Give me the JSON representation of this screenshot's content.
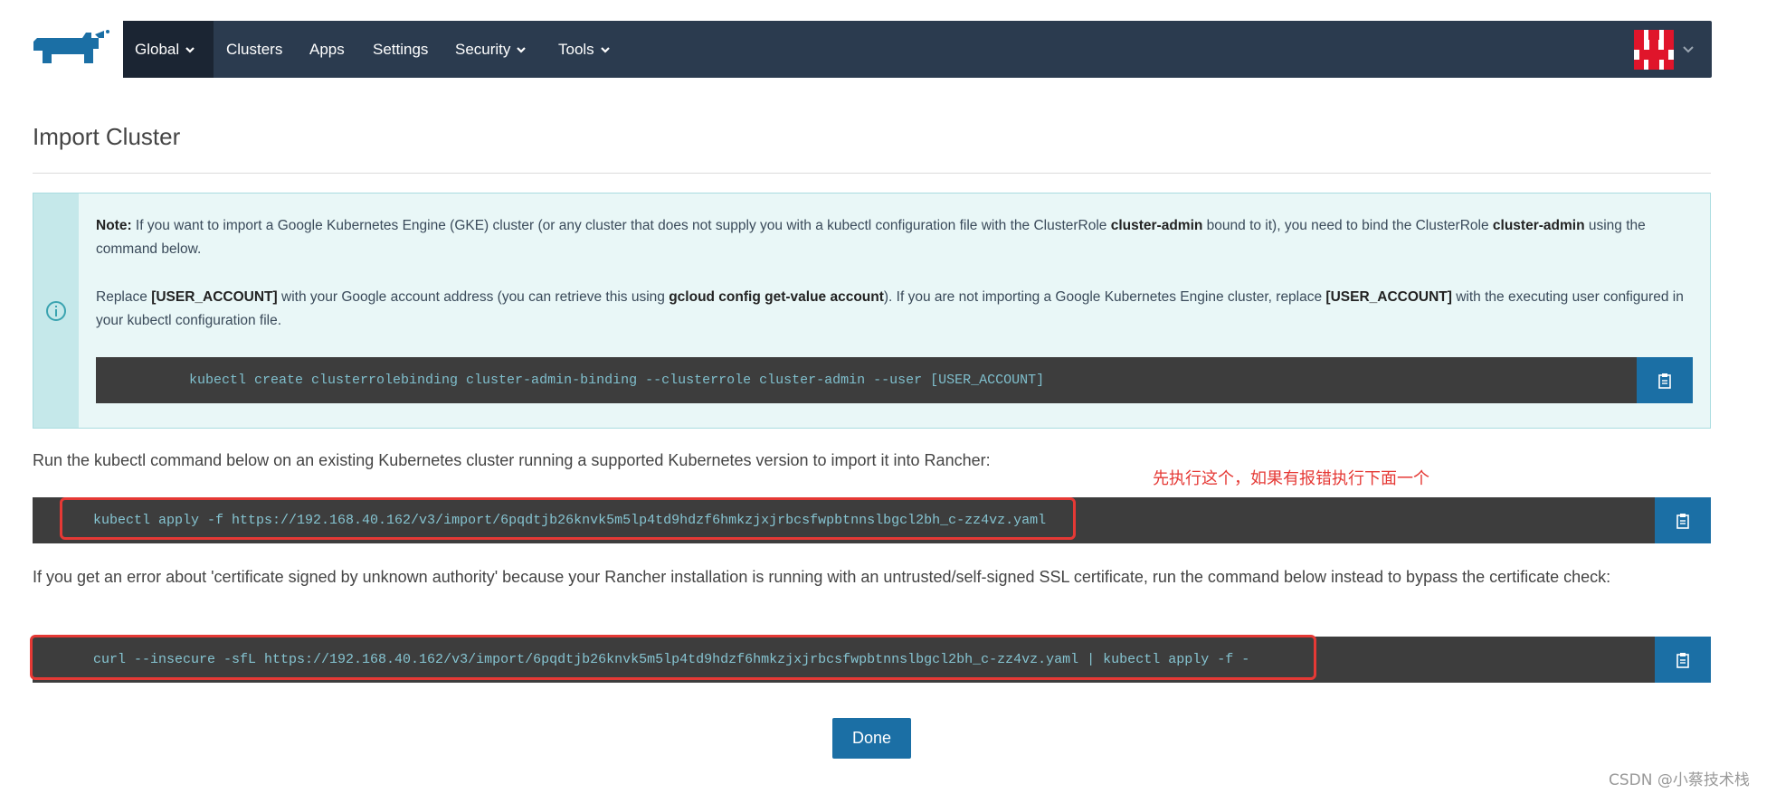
{
  "nav": {
    "global": "Global",
    "clusters": "Clusters",
    "apps": "Apps",
    "settings": "Settings",
    "security": "Security",
    "tools": "Tools"
  },
  "page": {
    "title": "Import Cluster"
  },
  "banner": {
    "note_label": "Note:",
    "note_text_1": " If you want to import a Google Kubernetes Engine (GKE) cluster (or any cluster that does not supply you with a kubectl configuration file with the ClusterRole ",
    "cluster_admin_1": "cluster-admin",
    "note_text_2": " bound to it), you need to bind the ClusterRole ",
    "cluster_admin_2": "cluster-admin",
    "note_text_3": " using the command below.",
    "replace_text_1": "Replace ",
    "user_account_1": "[USER_ACCOUNT]",
    "replace_text_2": " with your Google account address (you can retrieve this using ",
    "gcloud_cmd": "gcloud config get-value account",
    "replace_text_3": "). If you are not importing a Google Kubernetes Engine cluster, replace ",
    "user_account_2": "[USER_ACCOUNT]",
    "replace_text_4": " with the executing user configured in your kubectl configuration file.",
    "command": "kubectl create clusterrolebinding cluster-admin-binding --clusterrole cluster-admin --user [USER_ACCOUNT]"
  },
  "run_text": "Run the kubectl command below on an existing Kubernetes cluster running a supported Kubernetes version to import it into Rancher:",
  "annotation": "先执行这个，如果有报错执行下面一个",
  "command_1": "kubectl apply -f https://192.168.40.162/v3/import/6pqdtjb26knvk5m5lp4td9hdzf6hmkzjxjrbcsfwpbtnnslbgcl2bh_c-zz4vz.yaml",
  "error_text": "If you get an error about 'certificate signed by unknown authority' because your Rancher installation is running with an untrusted/self-signed SSL certificate, run the command below instead to bypass the certificate check:",
  "command_2": "curl --insecure -sfL https://192.168.40.162/v3/import/6pqdtjb26knvk5m5lp4td9hdzf6hmkzjxjrbcsfwpbtnnslbgcl2bh_c-zz4vz.yaml | kubectl apply -f -",
  "done_label": "Done",
  "watermark": "CSDN @小蔡技术栈",
  "icons": {
    "logo": "rancher-logo",
    "copy": "clipboard-icon",
    "info": "info-circle-icon",
    "chevron": "chevron-down-icon"
  },
  "colors": {
    "navbar": "#2b3b4f",
    "accent": "#1b6fa5",
    "banner_bg": "#e9f7f7",
    "highlight": "#e53935"
  }
}
